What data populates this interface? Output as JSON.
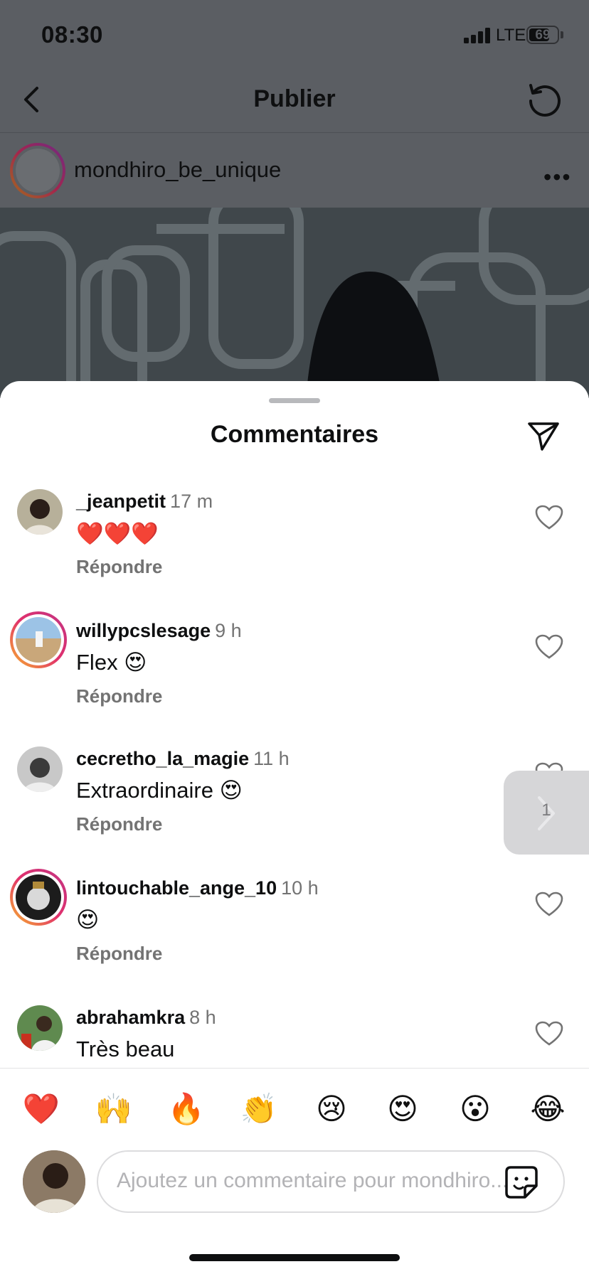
{
  "status_bar": {
    "time": "08:30",
    "network": "LTE",
    "battery": "69"
  },
  "header": {
    "title": "Publier"
  },
  "post": {
    "username": "mondhiro_be_unique"
  },
  "sheet": {
    "title": "Commentaires"
  },
  "comments": [
    {
      "username": "_jeanpetit",
      "time": "17 m",
      "text": "❤️❤️❤️",
      "reply_label": "Répondre"
    },
    {
      "username": "willypcslesage",
      "time": "9 h",
      "text": "Flex 😍",
      "reply_label": "Répondre"
    },
    {
      "username": "cecretho_la_magie",
      "time": "11 h",
      "text": "Extraordinaire 😍",
      "reply_label": "Répondre"
    },
    {
      "username": "lintouchable_ange_10",
      "time": "10 h",
      "text": "😍",
      "reply_label": "Répondre"
    },
    {
      "username": "abrahamkra",
      "time": "8 h",
      "text": "Très beau"
    }
  ],
  "floating_badge": {
    "count": "1"
  },
  "emoji_bar": [
    "❤️",
    "🙌",
    "🔥",
    "👏",
    "😢",
    "😍",
    "😮",
    "😂"
  ],
  "composer": {
    "placeholder": "Ajoutez un commentaire pour mondhiro..."
  },
  "colors": {
    "accent_ring_start": "#f8b62b",
    "accent_ring_end": "#c13584",
    "muted_text": "#737373"
  }
}
